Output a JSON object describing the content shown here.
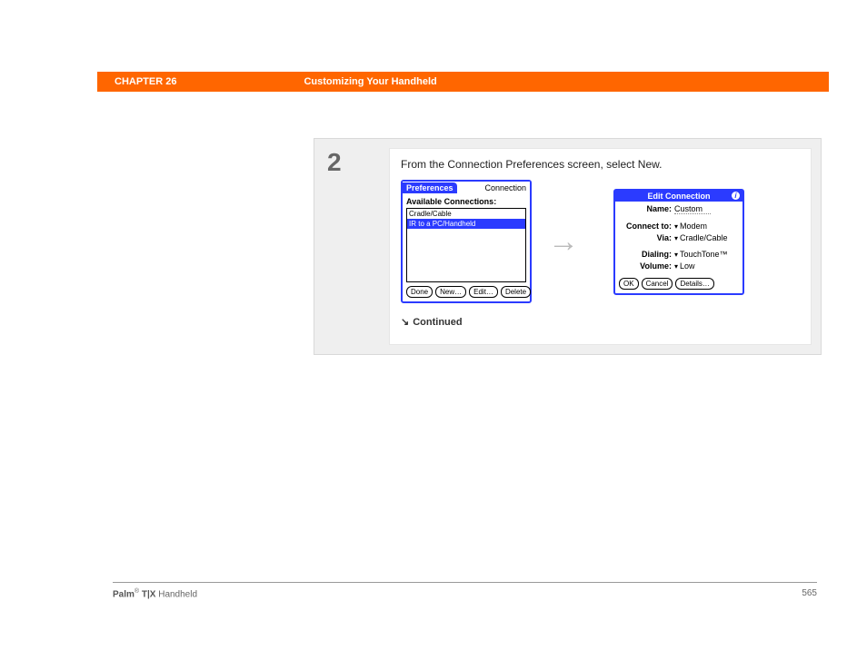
{
  "header": {
    "chapter_label": "CHAPTER 26",
    "chapter_title": "Customizing Your Handheld"
  },
  "step": {
    "number": "2",
    "instruction": "From the Connection Preferences screen, select New.",
    "continued_label": "Continued"
  },
  "palm_left": {
    "tab": "Preferences",
    "tab_alt": "Connection",
    "list_title": "Available Connections:",
    "items": [
      "Cradle/Cable",
      "IR to a PC/Handheld"
    ],
    "buttons": [
      "Done",
      "New…",
      "Edit…",
      "Delete"
    ]
  },
  "palm_right": {
    "title": "Edit Connection",
    "rows": {
      "name_label": "Name:",
      "name_value": "Custom",
      "connect_label": "Connect to:",
      "connect_value": "Modem",
      "via_label": "Via:",
      "via_value": "Cradle/Cable",
      "dialing_label": "Dialing:",
      "dialing_value": "TouchTone™",
      "volume_label": "Volume:",
      "volume_value": "Low"
    },
    "buttons": [
      "OK",
      "Cancel",
      "Details…"
    ]
  },
  "footer": {
    "product_bold_a": "Palm",
    "product_reg": "®",
    "product_bold_b": " T|X",
    "product_rest": " Handheld",
    "page": "565"
  }
}
